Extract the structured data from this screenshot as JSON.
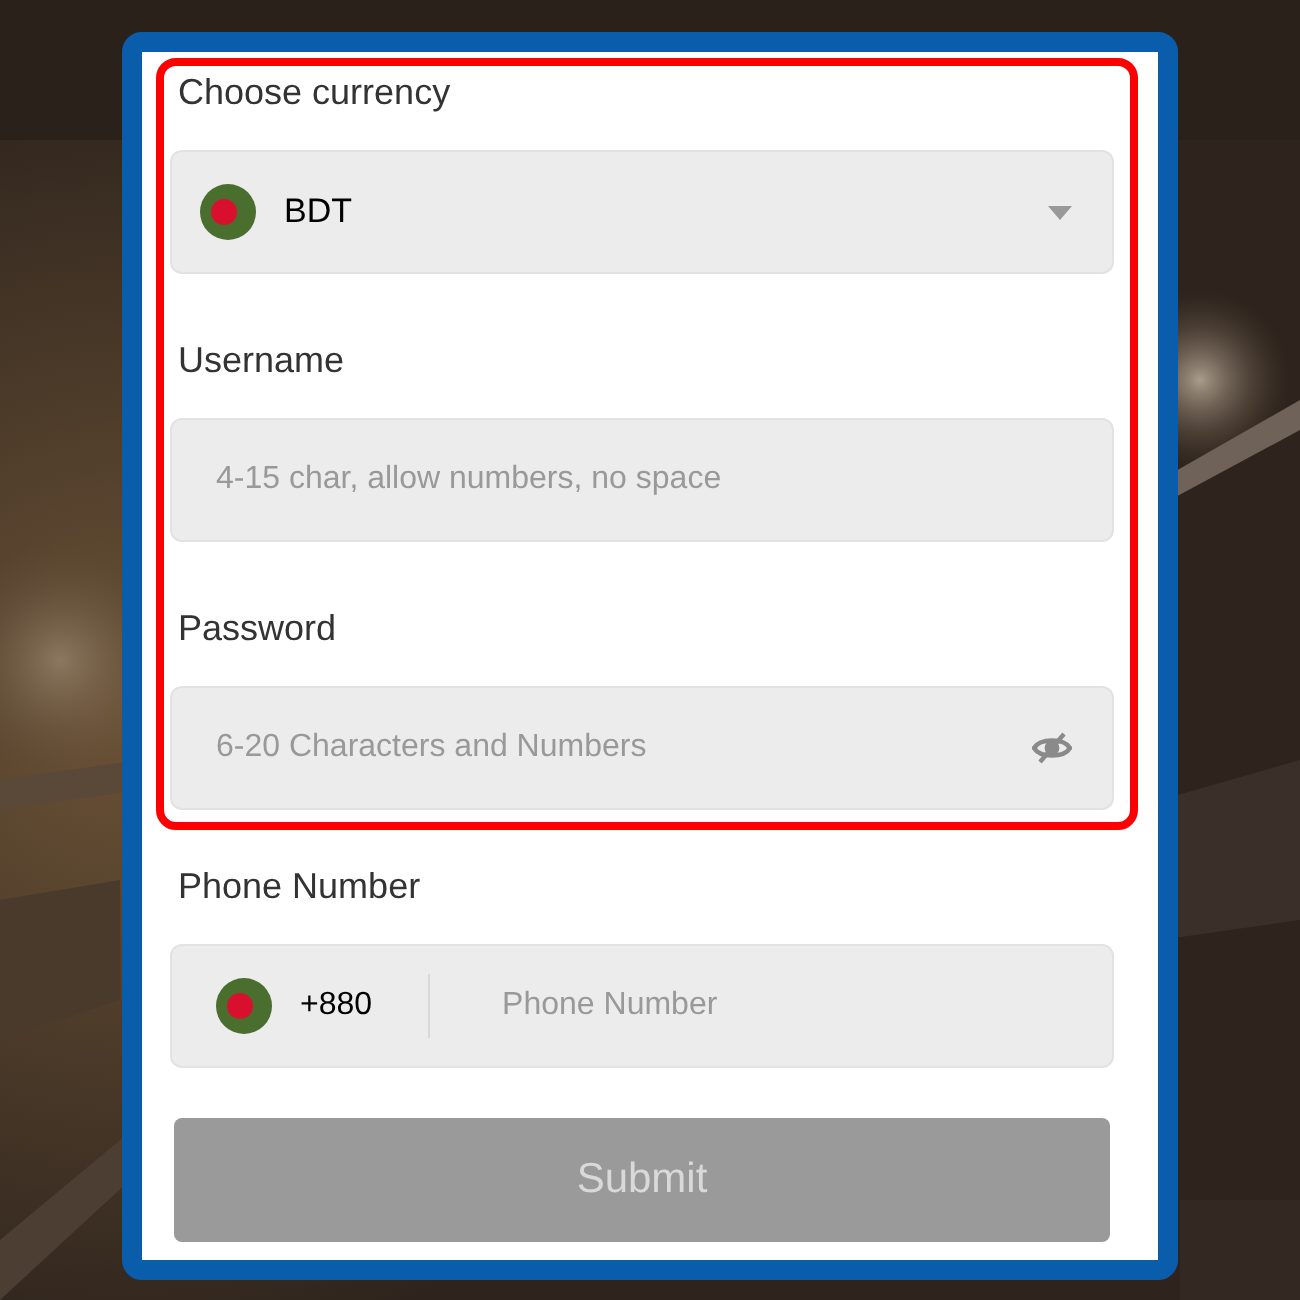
{
  "fields": [
    {
      "kind": "select",
      "label": "Choose currency",
      "value": "BDT",
      "highlighted": true
    },
    {
      "kind": "text",
      "label": "Username",
      "placeholder": "4-15 char, allow numbers, no space",
      "highlighted": true
    },
    {
      "kind": "password",
      "label": "Password",
      "placeholder": "6-20 Characters and Numbers",
      "highlighted": true
    },
    {
      "kind": "phone",
      "label": "Phone Number",
      "prefix": "+880",
      "placeholder": "Phone Number",
      "highlighted": false
    }
  ],
  "submit": {
    "label": "Submit",
    "disabled": true
  }
}
